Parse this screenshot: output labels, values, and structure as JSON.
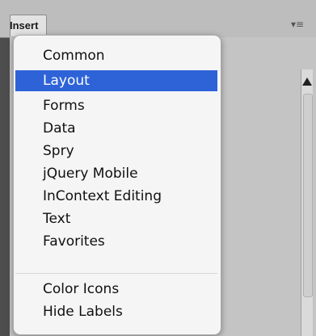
{
  "panel": {
    "tab_label": "Insert",
    "menu_icon": "panel-menu-icon",
    "menu_glyph": "▾≡"
  },
  "dropdown": {
    "items": [
      {
        "label": "Common",
        "selected": false
      },
      {
        "label": "Layout",
        "selected": true
      },
      {
        "label": "Forms",
        "selected": false
      },
      {
        "label": "Data",
        "selected": false
      },
      {
        "label": "Spry",
        "selected": false
      },
      {
        "label": "jQuery Mobile",
        "selected": false
      },
      {
        "label": "InContext Editing",
        "selected": false
      },
      {
        "label": "Text",
        "selected": false
      },
      {
        "label": "Favorites",
        "selected": false
      }
    ],
    "options": [
      {
        "label": "Color Icons"
      },
      {
        "label": "Hide Labels"
      }
    ]
  },
  "colors": {
    "selection": "#2e63d8",
    "menu_background": "#f5f5f5",
    "panel_background": "#c4c4c4"
  }
}
